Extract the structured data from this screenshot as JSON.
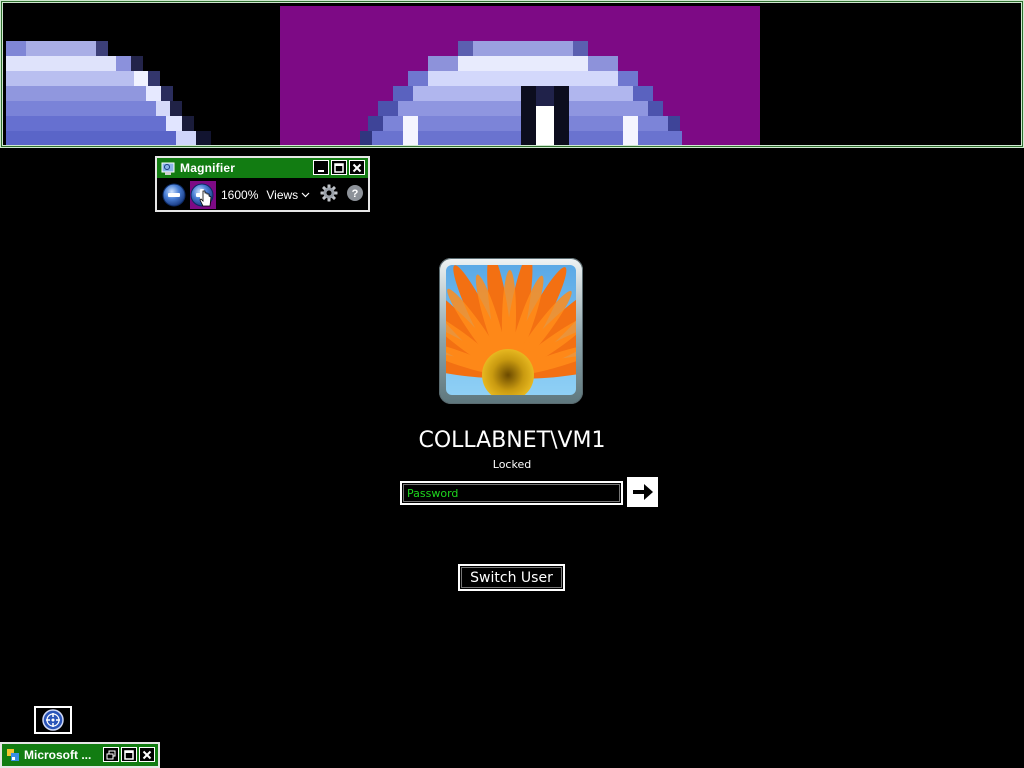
{
  "magnifier": {
    "title": "Magnifier",
    "zoom_level": "1600%",
    "views_label": "Views",
    "icons": {
      "app": "magnifier-app-icon",
      "minimize": "minimize-icon",
      "maximize": "maximize-icon",
      "close": "close-icon",
      "zoom_out": "zoom-out-icon",
      "zoom_in": "zoom-in-icon",
      "views_dropdown": "chevron-down-icon",
      "options": "gear-icon",
      "help": "help-icon"
    }
  },
  "logon": {
    "username": "COLLABNET\\VM1",
    "status": "Locked",
    "password_placeholder": "Password",
    "submit_icon": "arrow-right-icon",
    "switch_user_label": "Switch User",
    "user_picture": "orange-gerbera-flower"
  },
  "ease_of_access": {
    "icon": "ease-of-access-icon"
  },
  "minimized_window": {
    "title": "Microsoft ...",
    "icons": {
      "app": "application-icon",
      "restore": "restore-icon",
      "maximize": "maximize-icon",
      "close": "close-icon"
    }
  },
  "colors": {
    "background": "#000000",
    "titlebar_green": "#127c12",
    "highlight_purple": "#7d0a85",
    "password_text_green": "#1ed61e",
    "magnified_blue": "#6d78d6"
  }
}
